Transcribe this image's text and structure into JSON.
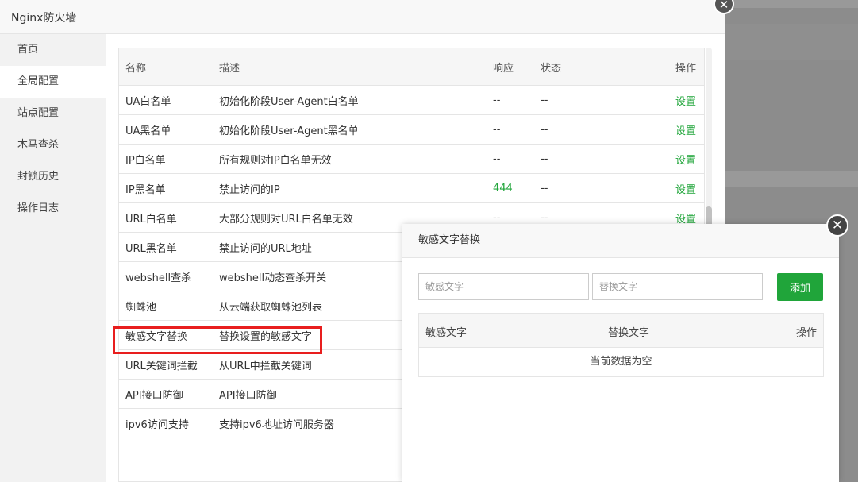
{
  "window": {
    "title": "Nginx防火墙"
  },
  "sidebar": {
    "items": [
      {
        "label": "首页"
      },
      {
        "label": "全局配置"
      },
      {
        "label": "站点配置"
      },
      {
        "label": "木马查杀"
      },
      {
        "label": "封锁历史"
      },
      {
        "label": "操作日志"
      }
    ]
  },
  "table": {
    "headers": {
      "name": "名称",
      "desc": "描述",
      "resp": "响应",
      "status": "状态",
      "op": "操作"
    },
    "rows": [
      {
        "name": "UA白名单",
        "desc": "初始化阶段User-Agent白名单",
        "resp": "--",
        "status": "--",
        "op": "设置"
      },
      {
        "name": "UA黑名单",
        "desc": "初始化阶段User-Agent黑名单",
        "resp": "--",
        "status": "--",
        "op": "设置"
      },
      {
        "name": "IP白名单",
        "desc": "所有规则对IP白名单无效",
        "resp": "--",
        "status": "--",
        "op": "设置"
      },
      {
        "name": "IP黑名单",
        "desc": "禁止访问的IP",
        "resp": "444",
        "status": "--",
        "op": "设置"
      },
      {
        "name": "URL白名单",
        "desc": "大部分规则对URL白名单无效",
        "resp": "--",
        "status": "--",
        "op": "设置"
      },
      {
        "name": "URL黑名单",
        "desc": "禁止访问的URL地址",
        "resp": "",
        "status": "",
        "op": ""
      },
      {
        "name": "webshell查杀",
        "desc": "webshell动态查杀开关",
        "resp": "",
        "status": "",
        "op": ""
      },
      {
        "name": "蜘蛛池",
        "desc": "从云端获取蜘蛛池列表",
        "resp": "",
        "status": "",
        "op": ""
      },
      {
        "name": "敏感文字替换",
        "desc": "替换设置的敏感文字",
        "resp": "",
        "status": "",
        "op": ""
      },
      {
        "name": "URL关键词拦截",
        "desc": "从URL中拦截关键词",
        "resp": "",
        "status": "",
        "op": ""
      },
      {
        "name": "API接口防御",
        "desc": "API接口防御",
        "resp": "",
        "status": "",
        "op": ""
      },
      {
        "name": "ipv6访问支持",
        "desc": "支持ipv6地址访问服务器",
        "resp": "",
        "status": "",
        "op": ""
      }
    ]
  },
  "dialog": {
    "title": "敏感文字替换",
    "sensitive_placeholder": "敏感文字",
    "replace_placeholder": "替换文字",
    "add_label": "添加",
    "headers": {
      "sensitive": "敏感文字",
      "replace": "替换文字",
      "op": "操作"
    },
    "empty_text": "当前数据为空"
  },
  "colors": {
    "accent": "#20a53a",
    "highlight": "#e81e1e"
  }
}
